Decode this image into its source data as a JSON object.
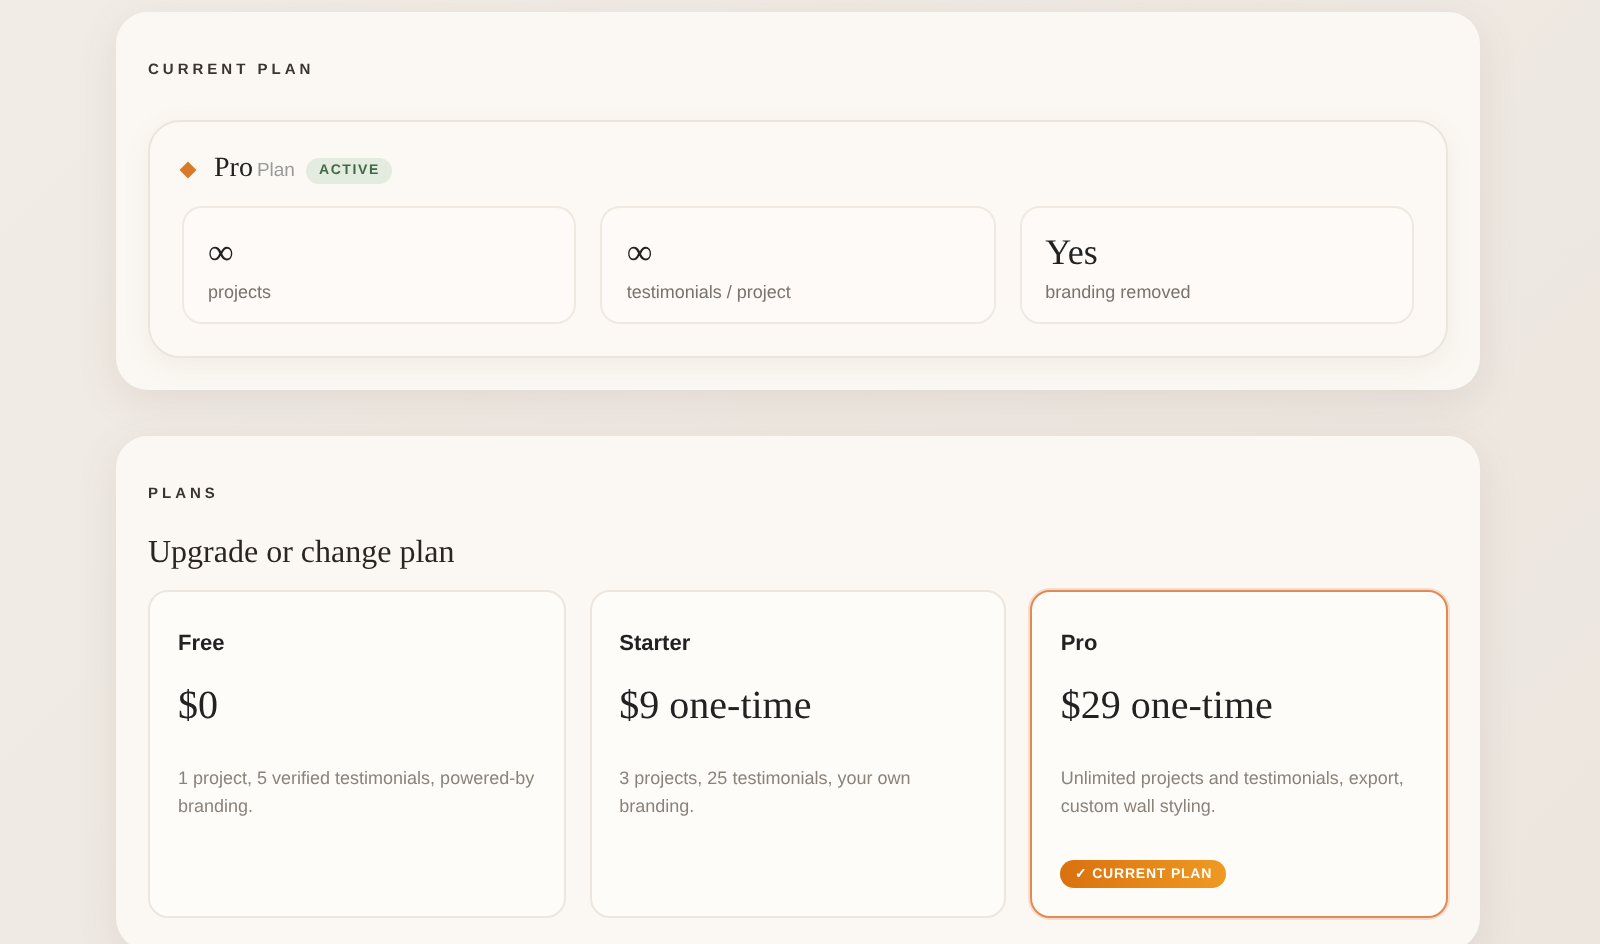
{
  "current_plan": {
    "heading": "CURRENT PLAN",
    "plan_name": "Pro",
    "plan_suffix": "Plan",
    "status": "ACTIVE",
    "stats": [
      {
        "value": "∞",
        "label": "projects"
      },
      {
        "value": "∞",
        "label": "testimonials / project"
      },
      {
        "value": "Yes",
        "label": "branding removed"
      }
    ]
  },
  "plans": {
    "heading": "PLANS",
    "title": "Upgrade or change plan",
    "items": [
      {
        "name": "Free",
        "price": "$0",
        "description": "1 project, 5 verified testimonials, powered-by branding.",
        "selected": false
      },
      {
        "name": "Starter",
        "price": "$9 one-time",
        "description": "3 projects, 25 testimonials, your own branding.",
        "selected": false
      },
      {
        "name": "Pro",
        "price": "$29 one-time",
        "description": "Unlimited projects and testimonials, export, custom wall styling.",
        "selected": true,
        "badge": "✓ CURRENT PLAN"
      }
    ]
  }
}
